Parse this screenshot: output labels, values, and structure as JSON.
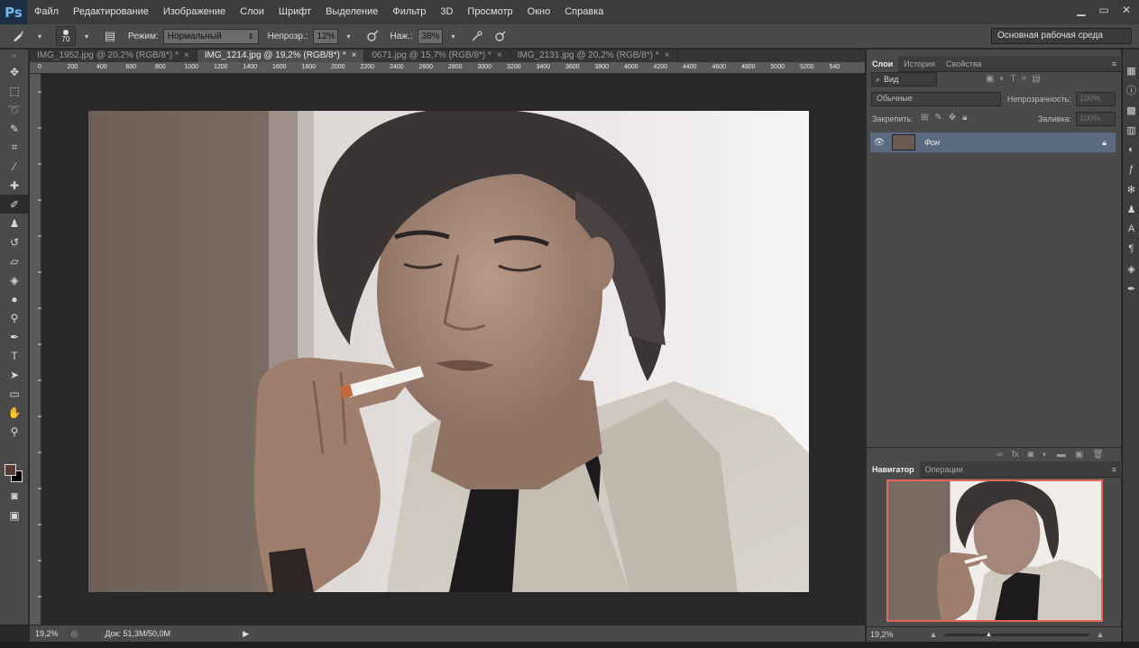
{
  "app": {
    "logo": "Ps"
  },
  "menu": [
    "Файл",
    "Редактирование",
    "Изображение",
    "Слои",
    "Шрифт",
    "Выделение",
    "Фильтр",
    "3D",
    "Просмотр",
    "Окно",
    "Справка"
  ],
  "options": {
    "brush_size": "70",
    "mode_label": "Режим:",
    "mode_value": "Нормальный",
    "opacity_label": "Непрозр.:",
    "opacity_value": "12%",
    "pressure_label": "Наж.:",
    "pressure_value": "38%",
    "workspace": "Основная рабочая среда"
  },
  "tabs": [
    {
      "label": "IMG_1952.jpg @ 20,2% (RGB/8*) *",
      "active": false
    },
    {
      "label": "IMG_1214.jpg @ 19,2% (RGB/8*) *",
      "active": true
    },
    {
      "label": "0671.jpg @ 15,7% (RGB/8*) *",
      "active": false
    },
    {
      "label": "IMG_2131.jpg @ 20,2% (RGB/8*) *",
      "active": false
    }
  ],
  "ruler_h": [
    "0",
    "200",
    "400",
    "600",
    "800",
    "1000",
    "1200",
    "1400",
    "1600",
    "1800",
    "2000",
    "2200",
    "2400",
    "2600",
    "2800",
    "3000",
    "3200",
    "3400",
    "3600",
    "3800",
    "4000",
    "4200",
    "4400",
    "4600",
    "4800",
    "5000",
    "5200",
    "540"
  ],
  "status": {
    "zoom": "19,2%",
    "doc": "Док: 51,3M/50,0M"
  },
  "layers_panel": {
    "tabs": [
      "Слои",
      "История",
      "Свойства"
    ],
    "filter": "Вид",
    "blend": "Обычные",
    "opacity_label": "Непрозрачность:",
    "opacity_value": "100%",
    "lock_label": "Закрепить:",
    "fill_label": "Заливка:",
    "fill_value": "100%",
    "layer_name": "Фон"
  },
  "navigator_panel": {
    "tabs": [
      "Навигатор",
      "Операции"
    ],
    "zoom": "19,2%"
  },
  "colors": {
    "foreground": "#5a3b33",
    "background": "#000000",
    "accent": "#5a6a80"
  }
}
